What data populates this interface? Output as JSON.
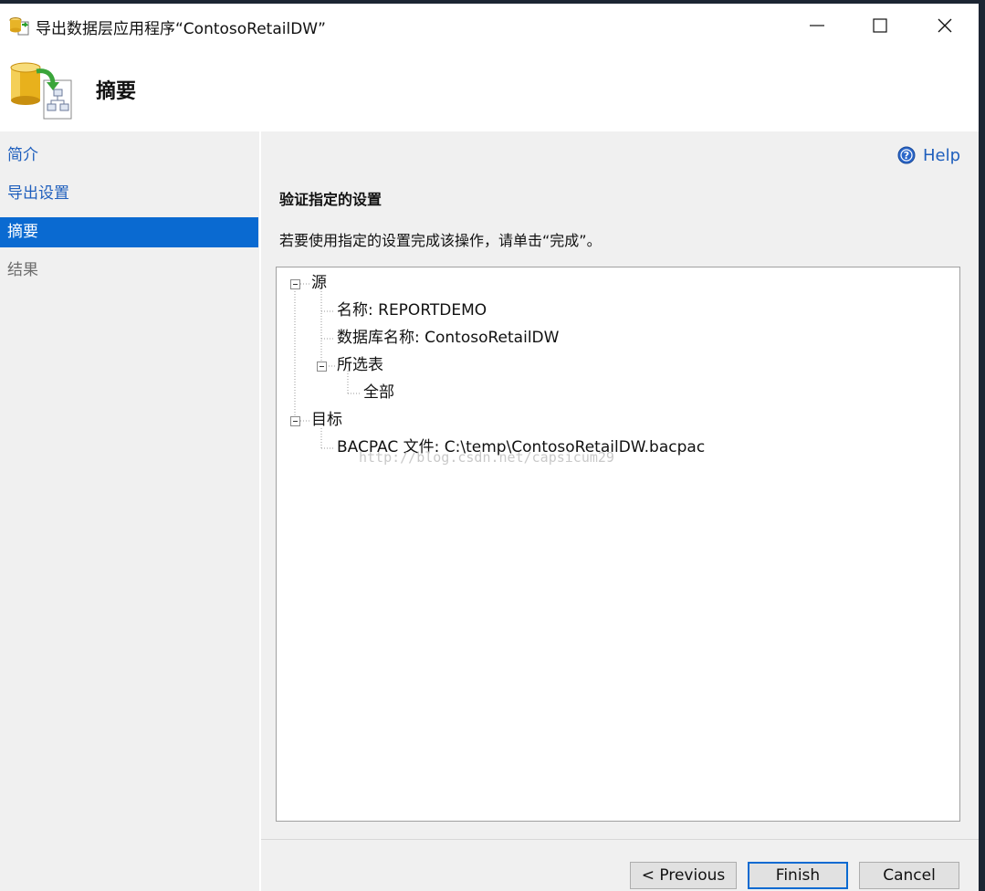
{
  "window": {
    "title": "导出数据层应用程序“ContosoRetailDW”"
  },
  "header": {
    "page_title": "摘要"
  },
  "sidebar": {
    "items": [
      {
        "label": "简介",
        "state": "link"
      },
      {
        "label": "导出设置",
        "state": "link"
      },
      {
        "label": "摘要",
        "state": "active"
      },
      {
        "label": "结果",
        "state": "disabled"
      }
    ]
  },
  "content": {
    "help_label": "Help",
    "section_heading": "验证指定的设置",
    "instruction": "若要使用指定的设置完成该操作，请单击“完成”。",
    "tree": {
      "source_label": "源",
      "source_name": "名称: REPORTDEMO",
      "source_database": "数据库名称: ContosoRetailDW",
      "selected_tables_label": "所选表",
      "selected_tables_value": "全部",
      "target_label": "目标",
      "target_file": "BACPAC 文件: C:\\temp\\ContosoRetailDW.bacpac"
    },
    "watermark": "http://blog.csdn.net/capsicum29"
  },
  "buttons": {
    "previous": "< Previous",
    "finish": "Finish",
    "cancel": "Cancel"
  },
  "colors": {
    "accent": "#0a6ad1",
    "link": "#1f5fbd",
    "panel_bg": "#f0f0f0"
  }
}
